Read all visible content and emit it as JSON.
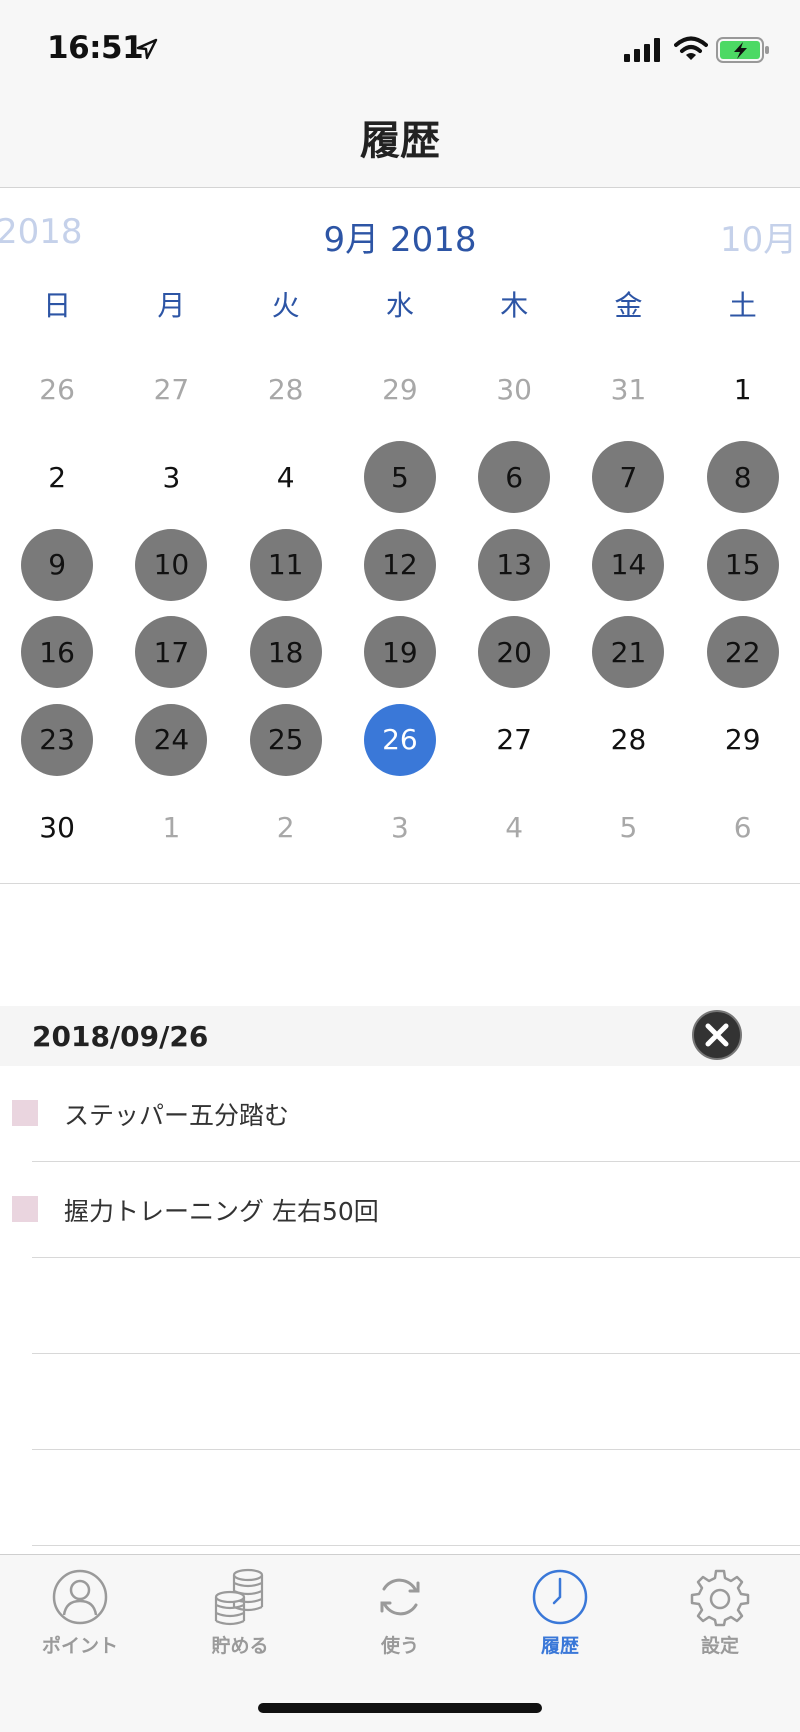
{
  "status_bar": {
    "time": "16:51"
  },
  "header": {
    "title": "履歴"
  },
  "calendar": {
    "prev_month_label": "2018",
    "current_month_label": "9月 2018",
    "next_month_label": "10月",
    "weekdays": [
      "日",
      "月",
      "火",
      "水",
      "木",
      "金",
      "土"
    ],
    "weeks": [
      [
        {
          "day": "26",
          "state": "muted"
        },
        {
          "day": "27",
          "state": "muted"
        },
        {
          "day": "28",
          "state": "muted"
        },
        {
          "day": "29",
          "state": "muted"
        },
        {
          "day": "30",
          "state": "muted"
        },
        {
          "day": "31",
          "state": "muted"
        },
        {
          "day": "1",
          "state": "normal"
        }
      ],
      [
        {
          "day": "2",
          "state": "normal"
        },
        {
          "day": "3",
          "state": "normal"
        },
        {
          "day": "4",
          "state": "normal"
        },
        {
          "day": "5",
          "state": "marked"
        },
        {
          "day": "6",
          "state": "marked"
        },
        {
          "day": "7",
          "state": "marked"
        },
        {
          "day": "8",
          "state": "marked"
        }
      ],
      [
        {
          "day": "9",
          "state": "marked"
        },
        {
          "day": "10",
          "state": "marked"
        },
        {
          "day": "11",
          "state": "marked"
        },
        {
          "day": "12",
          "state": "marked"
        },
        {
          "day": "13",
          "state": "marked"
        },
        {
          "day": "14",
          "state": "marked"
        },
        {
          "day": "15",
          "state": "marked"
        }
      ],
      [
        {
          "day": "16",
          "state": "marked"
        },
        {
          "day": "17",
          "state": "marked"
        },
        {
          "day": "18",
          "state": "marked"
        },
        {
          "day": "19",
          "state": "marked"
        },
        {
          "day": "20",
          "state": "marked"
        },
        {
          "day": "21",
          "state": "marked"
        },
        {
          "day": "22",
          "state": "marked"
        }
      ],
      [
        {
          "day": "23",
          "state": "marked"
        },
        {
          "day": "24",
          "state": "marked"
        },
        {
          "day": "25",
          "state": "marked"
        },
        {
          "day": "26",
          "state": "selected"
        },
        {
          "day": "27",
          "state": "normal"
        },
        {
          "day": "28",
          "state": "normal"
        },
        {
          "day": "29",
          "state": "normal"
        }
      ],
      [
        {
          "day": "30",
          "state": "normal"
        },
        {
          "day": "1",
          "state": "muted"
        },
        {
          "day": "2",
          "state": "muted"
        },
        {
          "day": "3",
          "state": "muted"
        },
        {
          "day": "4",
          "state": "muted"
        },
        {
          "day": "5",
          "state": "muted"
        },
        {
          "day": "6",
          "state": "muted"
        }
      ]
    ],
    "colors": {
      "accent": "#2d55a5",
      "selected": "#3a78d8",
      "marked": "#7a7a7a",
      "muted": "#a8a8a8"
    }
  },
  "detail": {
    "date": "2018/09/26",
    "close_icon": "close-icon",
    "entries": [
      {
        "label": "ステッパー五分踏む",
        "color": "#ead5df"
      },
      {
        "label": "握力トレーニング 左右50回",
        "color": "#ead5df"
      },
      {
        "label": "",
        "color": ""
      },
      {
        "label": "",
        "color": ""
      },
      {
        "label": "",
        "color": ""
      }
    ]
  },
  "tab_bar": {
    "tabs": [
      {
        "label": "ポイント",
        "icon": "person-icon",
        "active": false
      },
      {
        "label": "貯める",
        "icon": "coins-icon",
        "active": false
      },
      {
        "label": "使う",
        "icon": "refresh-icon",
        "active": false
      },
      {
        "label": "履歴",
        "icon": "clock-icon",
        "active": true
      },
      {
        "label": "設定",
        "icon": "gear-icon",
        "active": false
      }
    ]
  }
}
